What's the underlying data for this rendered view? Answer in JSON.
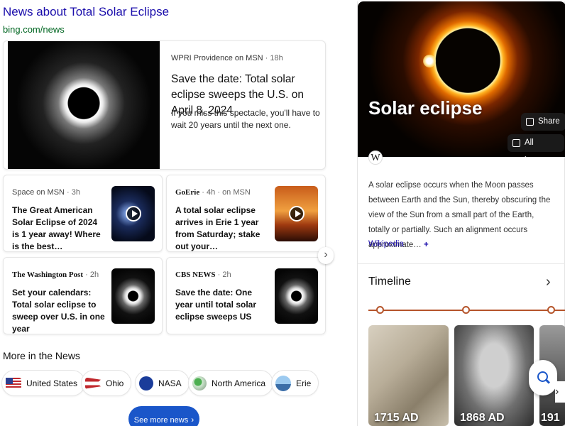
{
  "news": {
    "title": "News about Total Solar Eclipse",
    "source": "bing.com/news",
    "hero": {
      "publisher": "WPRI Providence on MSN",
      "time": "18h",
      "headline": "Save the date: Total solar eclipse sweeps the U.S. on April 8, 2024",
      "snippet": "If you miss this spectacle, you'll have to wait 20 years until the next one."
    },
    "cards": [
      {
        "publisher": "Space on MSN",
        "time": "3h",
        "headline": "The Great American Solar Eclipse of 2024 is 1 year away! Where is the best…",
        "video": true
      },
      {
        "publisher": "GoErie",
        "suffix": "on MSN",
        "time": "4h",
        "headline": "A total solar eclipse arrives in Erie 1 year from Saturday; stake out your…",
        "video": true
      },
      {
        "publisher": "The Washington Post",
        "time": "2h",
        "headline": "Set your calendars: Total solar eclipse to sweep over U.S. in one year",
        "video": false
      },
      {
        "publisher": "CBS NEWS",
        "time": "2h",
        "headline": "Save the date: One year until total solar eclipse sweeps US",
        "video": false
      }
    ],
    "more_title": "More in the News",
    "chips": [
      "United States",
      "Ohio",
      "NASA",
      "North America",
      "Erie"
    ],
    "see_more": "See more news"
  },
  "knowledge": {
    "title": "Solar eclipse",
    "share_label": "Share",
    "all_images_label": "All images",
    "description": "A solar eclipse occurs when the Moon passes between Earth and the Sun, thereby obscuring the view of the Sun from a small part of the Earth, totally or partially. Such an alignment occurs approximate…",
    "source": "Wikipedia",
    "timeline_title": "Timeline",
    "timeline": [
      "1715 AD",
      "1868 AD",
      "191"
    ]
  },
  "colors": {
    "link": "#1a0dab",
    "source_green": "#006621",
    "accent_blue": "#1a56c9",
    "timeline": "#b5542a"
  }
}
